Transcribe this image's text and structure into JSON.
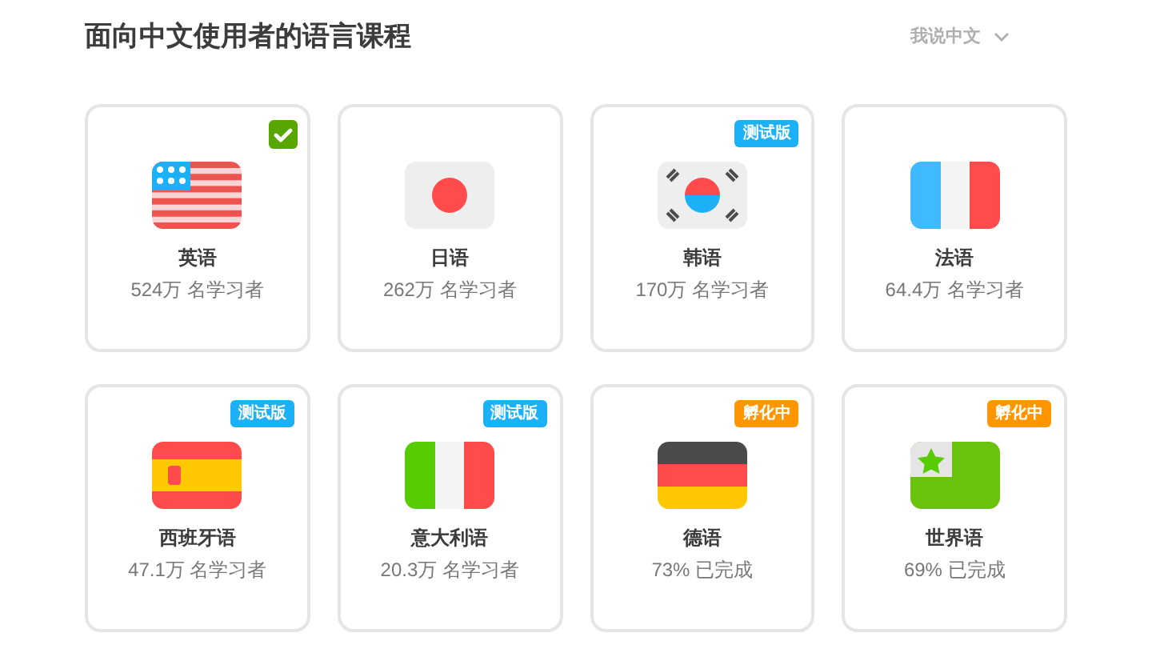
{
  "title": "面向中文使用者的语言课程",
  "language_menu": {
    "label": "我说中文"
  },
  "courses": [
    {
      "kind": "us",
      "name": "英语",
      "stat": "524万 名学习者",
      "selected": true
    },
    {
      "kind": "jp",
      "name": "日语",
      "stat": "262万 名学习者",
      "selected": false
    },
    {
      "kind": "kr",
      "name": "韩语",
      "stat": "170万 名学习者",
      "selected": false,
      "badge": {
        "text": "测试版",
        "kind": "beta"
      }
    },
    {
      "kind": "fr",
      "name": "法语",
      "stat": "64.4万 名学习者",
      "selected": false
    },
    {
      "kind": "es",
      "name": "西班牙语",
      "stat": "47.1万 名学习者",
      "selected": false,
      "badge": {
        "text": "测试版",
        "kind": "beta"
      }
    },
    {
      "kind": "it",
      "name": "意大利语",
      "stat": "20.3万 名学习者",
      "selected": false,
      "badge": {
        "text": "测试版",
        "kind": "beta"
      }
    },
    {
      "kind": "de",
      "name": "德语",
      "stat": "73% 已完成",
      "selected": false,
      "badge": {
        "text": "孵化中",
        "kind": "incubating"
      }
    },
    {
      "kind": "eo",
      "name": "世界语",
      "stat": "69% 已完成",
      "selected": false,
      "badge": {
        "text": "孵化中",
        "kind": "incubating"
      }
    }
  ]
}
